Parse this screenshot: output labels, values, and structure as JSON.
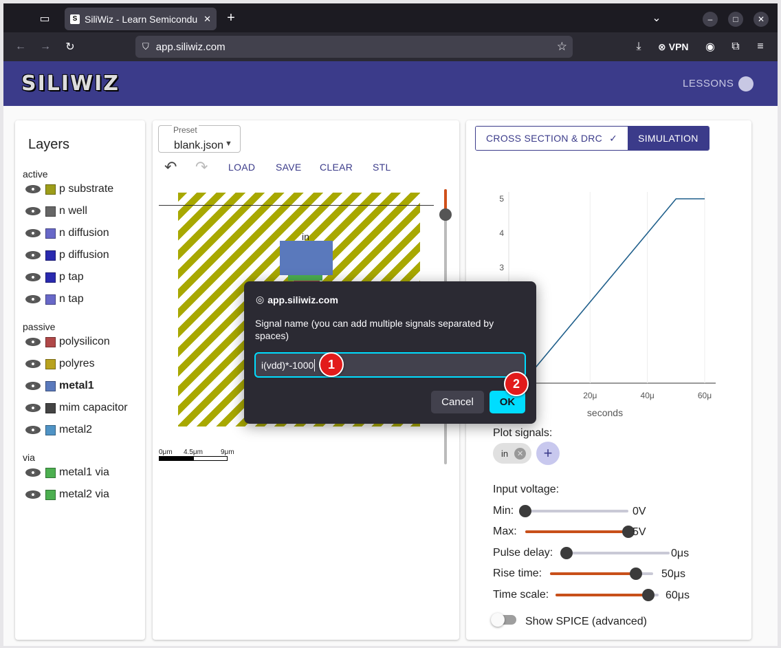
{
  "browser": {
    "tab_title": "SiliWiz - Learn Semicondu",
    "url": "app.siliwiz.com",
    "vpn_label": "VPN"
  },
  "app": {
    "logo": "SILIWIZ",
    "lessons": "LESSONS"
  },
  "layers": {
    "title": "Layers",
    "groups": {
      "active": "active",
      "passive": "passive",
      "via": "via"
    },
    "items": [
      {
        "label": "p substrate",
        "color": "#9d9d19"
      },
      {
        "label": "n well",
        "color": "#666666"
      },
      {
        "label": "n diffusion",
        "color": "#6868c8"
      },
      {
        "label": "p diffusion",
        "color": "#2a2aaf"
      },
      {
        "label": "p tap",
        "color": "#2a2aaf"
      },
      {
        "label": "n tap",
        "color": "#6868c8"
      },
      {
        "label": "polysilicon",
        "color": "#b04848"
      },
      {
        "label": "polyres",
        "color": "#b8a21e"
      },
      {
        "label": "metal1",
        "color": "#5a79bc"
      },
      {
        "label": "mim capacitor",
        "color": "#444444"
      },
      {
        "label": "metal2",
        "color": "#4f93c5"
      },
      {
        "label": "metal1 via",
        "color": "#4caf50"
      },
      {
        "label": "metal2 via",
        "color": "#4caf50"
      }
    ]
  },
  "editor": {
    "preset_label": "Preset",
    "preset_value": "blank.json",
    "load": "LOAD",
    "save": "SAVE",
    "clear": "CLEAR",
    "stl": "STL",
    "canvas_label": "in",
    "scale": {
      "s0": "0μm",
      "s1": "4.5μm",
      "s2": "9μm"
    }
  },
  "simulation": {
    "tab_cross": "CROSS SECTION & DRC",
    "tab_sim": "SIMULATION",
    "xlabel": "seconds",
    "plot_signals": "Plot signals:",
    "signal_chip": "in",
    "input_voltage": "Input voltage:",
    "sliders": [
      {
        "label": "Min:",
        "value": "0V",
        "fraction": 0.0
      },
      {
        "label": "Max:",
        "value": "5V",
        "fraction": 1.0
      },
      {
        "label": "Pulse delay:",
        "value": "0μs",
        "fraction": 0.0
      },
      {
        "label": "Rise time:",
        "value": "50μs",
        "fraction": 0.83
      },
      {
        "label": "Time scale:",
        "value": "60μs",
        "fraction": 0.9
      }
    ],
    "spice": "Show SPICE (advanced)"
  },
  "chart_data": {
    "type": "line",
    "xlabel": "seconds",
    "ylabel": "",
    "x_ticks": [
      "20μ",
      "40μ",
      "60μ"
    ],
    "y_ticks": [
      "3",
      "4",
      "5"
    ],
    "xlim": [
      0,
      60
    ],
    "ylim": [
      0,
      5.2
    ],
    "series": [
      {
        "x": [
          0,
          50,
          60
        ],
        "values": [
          0,
          5,
          5
        ]
      }
    ]
  },
  "dialog": {
    "origin": "app.siliwiz.com",
    "message": "Signal name (you can add multiple signals separated by spaces)",
    "input_value": "i(vdd)*-1000",
    "cancel": "Cancel",
    "ok": "OK",
    "badge1": "1",
    "badge2": "2"
  }
}
